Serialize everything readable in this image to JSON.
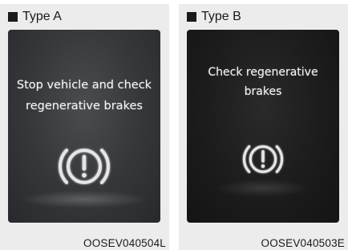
{
  "panels": [
    {
      "title": "Type A",
      "message": "Stop vehicle and check\nregenerative brakes",
      "code": "OOSEV040504L",
      "icon": "brake-warning-icon"
    },
    {
      "title": "Type B",
      "message": "Check regenerative\nbrakes",
      "code": "OOSEV040503E",
      "icon": "brake-warning-icon"
    }
  ],
  "colors": {
    "background": "#ffffff",
    "panel": "#ececec",
    "screen_a": "#36383b",
    "screen_b": "#1c1c1c",
    "text_on_screen": "#f2f2f2",
    "icon": "#e6e6e6"
  }
}
